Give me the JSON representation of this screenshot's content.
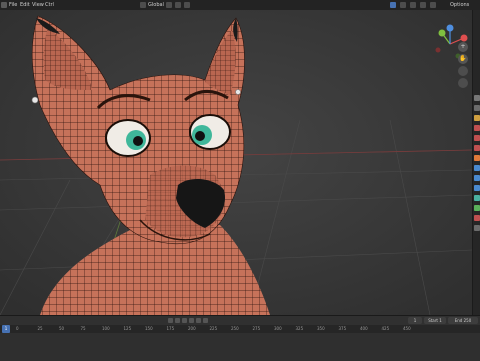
{
  "topbar": {
    "menu": [
      "File",
      "Edit",
      "View",
      "Ctrl"
    ],
    "mode": "Global",
    "options": "Options"
  },
  "viewport": {
    "gizmo_axes": [
      "X",
      "Y",
      "Z"
    ],
    "nav_buttons": [
      "+",
      "✋",
      "🎥",
      "▦"
    ]
  },
  "timeline": {
    "start_label": "Start",
    "start_value": "1",
    "end_label": "End",
    "end_value": "250",
    "current_frame": "1",
    "ruler": [
      "0",
      "25",
      "50",
      "75",
      "100",
      "125",
      "150",
      "175",
      "200",
      "225",
      "250",
      "275",
      "300",
      "325",
      "350",
      "375",
      "400",
      "425",
      "450"
    ]
  },
  "colors": {
    "accent": "#4772b3",
    "skin": "#c6725a",
    "iris": "#3fb79a",
    "nose": "#161616"
  }
}
